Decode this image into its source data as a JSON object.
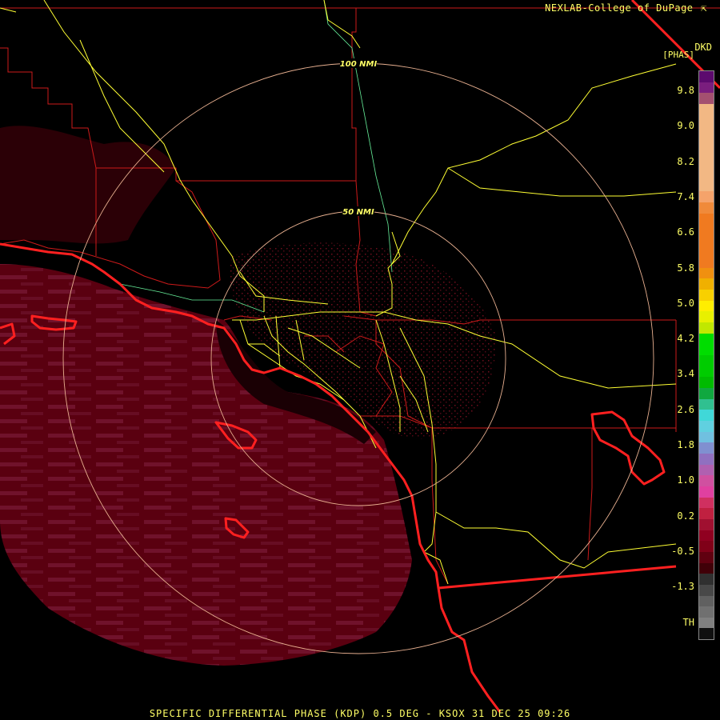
{
  "header": {
    "credit": "NEXLAB-College of DuPage",
    "credit_icon": "external-link-icon",
    "product_code": "DKD",
    "units": "[PHAS]"
  },
  "footer": {
    "caption": "SPECIFIC DIFFERENTIAL PHASE (KDP) 0.5 DEG - KSOX 31 DEC 25 09:26"
  },
  "range_rings": [
    {
      "label": "100 NMI"
    },
    {
      "label": "50 NMI"
    }
  ],
  "color_scale": {
    "ticks": [
      "9.8",
      "9.0",
      "8.2",
      "7.4",
      "6.6",
      "5.8",
      "5.0",
      "4.2",
      "3.4",
      "2.6",
      "1.8",
      "1.0",
      "0.2",
      "-0.5",
      "-1.3",
      "TH"
    ],
    "colors": [
      "#5c0a6e",
      "#7a1e7e",
      "#a45070",
      "#f2b884",
      "#f2b884",
      "#f2b884",
      "#f2b884",
      "#f2b884",
      "#f2b884",
      "#f2b884",
      "#f2b884",
      "#f5a36b",
      "#f08a3a",
      "#f07a20",
      "#f07a20",
      "#f07a20",
      "#f07a20",
      "#f07a20",
      "#f09010",
      "#f0b000",
      "#f8d000",
      "#ffee00",
      "#e8f000",
      "#c0e800",
      "#00dd00",
      "#00dd00",
      "#00cc00",
      "#00cc00",
      "#00bb00",
      "#10a840",
      "#30c090",
      "#40d8d8",
      "#60d0e0",
      "#70c0e0",
      "#8090d0",
      "#9070c0",
      "#b060b0",
      "#d050a0",
      "#e040a0",
      "#d03060",
      "#c02040",
      "#a01030",
      "#900020",
      "#800018",
      "#600010",
      "#400008",
      "#303030",
      "#484848",
      "#606060",
      "#707070",
      "#808080",
      "#101010"
    ]
  },
  "colors": {
    "coastline": "#ff2020",
    "county_lines": "#cc1a1a",
    "highways": "#ffff33",
    "rivers": "#66ee99",
    "range_rings": "#e8b090",
    "echo_dark": "#5a0010",
    "echo_light": "#7a1030"
  }
}
